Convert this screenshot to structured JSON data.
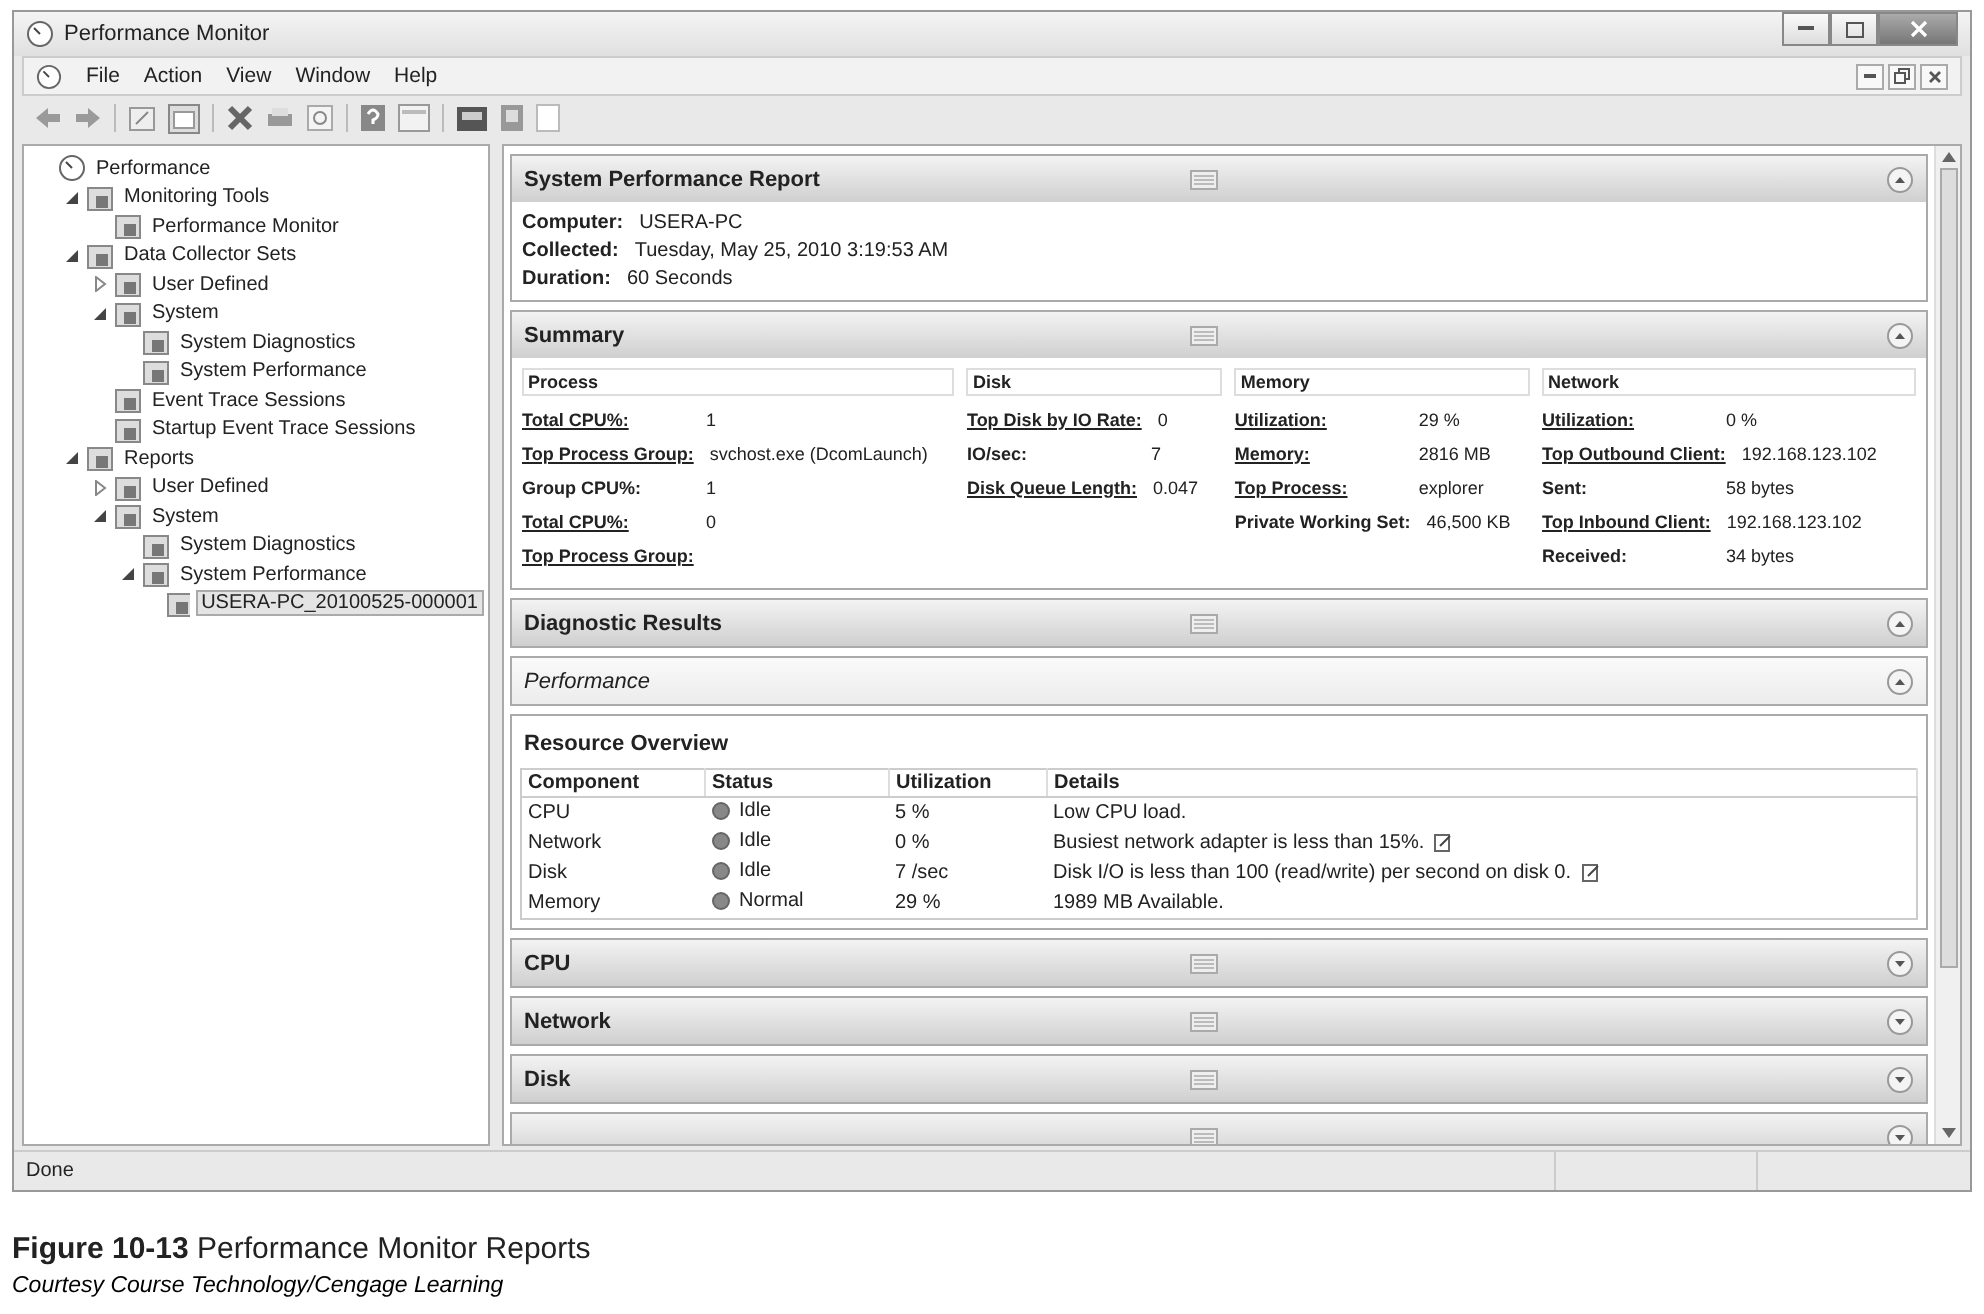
{
  "window": {
    "title": "Performance Monitor"
  },
  "menu": [
    "File",
    "Action",
    "View",
    "Window",
    "Help"
  ],
  "tree": [
    {
      "label": "Performance",
      "selected": false,
      "children": [
        {
          "label": "Monitoring Tools",
          "expanded": true,
          "selected": false,
          "children": [
            {
              "label": "Performance Monitor",
              "selected": false
            }
          ]
        },
        {
          "label": "Data Collector Sets",
          "expanded": true,
          "selected": false,
          "children": [
            {
              "label": "User Defined",
              "expanded": false,
              "selected": false
            },
            {
              "label": "System",
              "expanded": true,
              "selected": false,
              "children": [
                {
                  "label": "System Diagnostics",
                  "selected": false
                },
                {
                  "label": "System Performance",
                  "selected": false
                }
              ]
            },
            {
              "label": "Event Trace Sessions",
              "selected": false
            },
            {
              "label": "Startup Event Trace Sessions",
              "selected": false
            }
          ]
        },
        {
          "label": "Reports",
          "expanded": true,
          "selected": false,
          "children": [
            {
              "label": "User Defined",
              "expanded": false,
              "selected": false
            },
            {
              "label": "System",
              "expanded": true,
              "selected": false,
              "children": [
                {
                  "label": "System Diagnostics",
                  "selected": false
                },
                {
                  "label": "System Performance",
                  "expanded": true,
                  "selected": false,
                  "children": [
                    {
                      "label": "USERA-PC_20100525-000001",
                      "selected": true
                    }
                  ]
                }
              ]
            }
          ]
        }
      ]
    }
  ],
  "report": {
    "title": "System Performance Report",
    "expanded": true,
    "fields": [
      {
        "label": "Computer:",
        "value": "USERA-PC"
      },
      {
        "label": "Collected:",
        "value": "Tuesday, May 25, 2010 3:19:53 AM"
      },
      {
        "label": "Duration:",
        "value": "60 Seconds"
      }
    ]
  },
  "summary": {
    "title": "Summary",
    "expanded": true,
    "columns": [
      {
        "heading": "Process",
        "rows": [
          {
            "label": "Total CPU%:",
            "value": "1",
            "link": true
          },
          {
            "label": "Top Process Group:",
            "value": "svchost.exe (DcomLaunch)",
            "link": true
          },
          {
            "label": "Group CPU%:",
            "value": "1",
            "link": false
          },
          {
            "label": "Total CPU%:",
            "value": "0",
            "link": true
          },
          {
            "label": "Top Process Group:",
            "value": "",
            "link": true
          }
        ]
      },
      {
        "heading": "Disk",
        "rows": [
          {
            "label": "Top Disk by IO Rate:",
            "value": "0",
            "link": true
          },
          {
            "label": "IO/sec:",
            "value": "7",
            "link": false
          },
          {
            "label": "Disk Queue Length:",
            "value": "0.047",
            "link": true
          }
        ]
      },
      {
        "heading": "Memory",
        "rows": [
          {
            "label": "Utilization:",
            "value": "29 %",
            "link": true
          },
          {
            "label": "Memory:",
            "value": "2816 MB",
            "link": true
          },
          {
            "label": "Top Process:",
            "value": "explorer",
            "link": true
          },
          {
            "label": "Private Working Set:",
            "value": "46,500 KB",
            "link": false
          }
        ]
      },
      {
        "heading": "Network",
        "rows": [
          {
            "label": "Utilization:",
            "value": "0 %",
            "link": true
          },
          {
            "label": "Top Outbound Client:",
            "value": "192.168.123.102",
            "link": true
          },
          {
            "label": "Sent:",
            "value": "58 bytes",
            "link": false
          },
          {
            "label": "Top Inbound Client:",
            "value": "192.168.123.102",
            "link": true
          },
          {
            "label": "Received:",
            "value": "34 bytes",
            "link": false
          }
        ]
      }
    ]
  },
  "diagnostic": {
    "title": "Diagnostic Results",
    "expanded": true
  },
  "performance": {
    "title": "Performance",
    "expanded": true,
    "overview": {
      "title": "Resource Overview",
      "columns": [
        "Component",
        "Status",
        "Utilization",
        "Details"
      ],
      "rows": [
        {
          "component": "CPU",
          "status": "Idle",
          "utilization": "5 %",
          "details": "Low CPU load.",
          "note": false
        },
        {
          "component": "Network",
          "status": "Idle",
          "utilization": "0 %",
          "details": "Busiest network adapter is less than 15%.",
          "note": true
        },
        {
          "component": "Disk",
          "status": "Idle",
          "utilization": "7 /sec",
          "details": "Disk I/O is less than 100 (read/write) per second on disk 0.",
          "note": true
        },
        {
          "component": "Memory",
          "status": "Normal",
          "utilization": "29 %",
          "details": "1989 MB Available.",
          "note": false
        }
      ]
    }
  },
  "sections": [
    {
      "title": "CPU",
      "expanded": false
    },
    {
      "title": "Network",
      "expanded": false
    },
    {
      "title": "Disk",
      "expanded": false
    },
    {
      "expanded": false
    }
  ],
  "status_bar": "Done",
  "caption": {
    "title": "**Figure 10-13**  Performance Monitor Reports",
    "credit": "Courtesy Course Technology/Cengage Learning"
  }
}
